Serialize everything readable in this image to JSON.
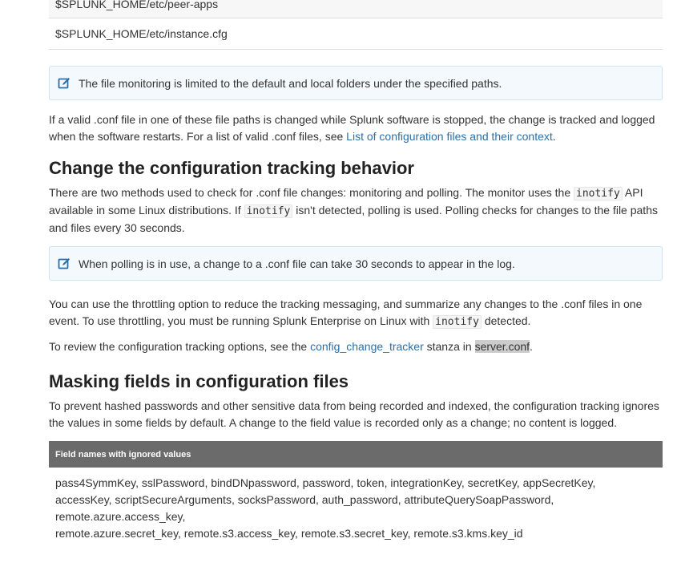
{
  "paths_table": {
    "rows": [
      "$SPLUNK_HOME/etc/peer-apps",
      "$SPLUNK_HOME/etc/instance.cfg"
    ]
  },
  "note1": {
    "icon": "edit-note-icon",
    "text": "The file monitoring is limited to the default and local folders under the specified paths."
  },
  "para1": {
    "text": "If a valid .conf file in one of these file paths is changed while Splunk software is stopped, the change is tracked and logged when the software restarts. For a list of valid .conf files, see ",
    "link": "List of configuration files and their context",
    "end": "."
  },
  "section1": {
    "heading": "Change the configuration tracking behavior",
    "p1": {
      "a": "There are two methods used to check for .conf file changes: monitoring and polling. The monitor uses the ",
      "code1": "inotify",
      "b": " API available in some Linux distributions. If ",
      "code2": "inotify",
      "c": " isn't detected, polling is used. Polling checks for changes to the file paths and files every 30 seconds."
    },
    "note": {
      "icon": "edit-note-icon",
      "text": "When polling is in use, a change to a .conf file can take 30 seconds to appear in the log."
    },
    "p2": {
      "a": "You can use the throttling option to reduce the tracking messaging, and summarize any changes to the .conf files in one event. To use throttling, you must be running Splunk Enterprise on Linux with ",
      "code": "inotify",
      "b": " detected."
    },
    "p3": {
      "a": "To review the configuration tracking options, see the ",
      "link": "config_change_tracker",
      "b": " stanza in ",
      "hl": "server.conf",
      "c": "."
    }
  },
  "section2": {
    "heading": "Masking fields in configuration files",
    "p1": "To prevent hashed passwords and other sensitive data from being recorded and indexed, the configuration tracking ignores the values in some fields by default. A change to the field value is recorded only as a change; no content is logged.",
    "table": {
      "header": "Field names with ignored values",
      "lines": [
        "pass4SymmKey, sslPassword, bindDNpassword, password, token, integrationKey, secretKey, appSecretKey,",
        "accessKey, scriptSecureArguments, socksPassword, auth_password, attributeQuerySoapPassword,",
        "remote.azure.access_key,",
        "remote.azure.secret_key, remote.s3.access_key, remote.s3.secret_key, remote.s3.kms.key_id"
      ]
    }
  },
  "colors": {
    "link": "#2b6fa8",
    "note_bg": "#f3f9fd",
    "note_border": "#cfe4f1",
    "note_icon": "#2b6fa8",
    "table_header_bg": "#6b6b6b"
  }
}
